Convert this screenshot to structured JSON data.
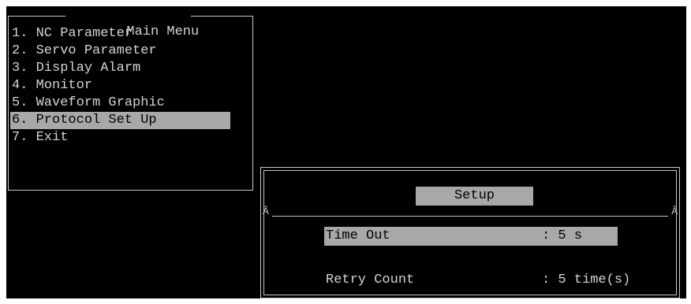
{
  "main_menu": {
    "title": "Main Menu",
    "items": [
      {
        "label": "1. NC Parameter"
      },
      {
        "label": "2. Servo Parameter"
      },
      {
        "label": "3. Display Alarm"
      },
      {
        "label": "4. Monitor"
      },
      {
        "label": "5. Waveform Graphic"
      },
      {
        "label": "6. Protocol Set Up"
      },
      {
        "label": "7. Exit"
      }
    ],
    "selected_index": 5
  },
  "setup_dialog": {
    "title": "Setup",
    "divider_glyph": "Â",
    "fields": [
      {
        "label": "Time Out",
        "value": ": 5 s",
        "selected": true
      },
      {
        "label": "Retry Count",
        "value": ": 5 time(s)",
        "selected": false
      }
    ]
  },
  "colors": {
    "background": "#000000",
    "text": "#d4d4d4",
    "highlight": "#a8a8a8",
    "border": "#c8c8c8"
  }
}
